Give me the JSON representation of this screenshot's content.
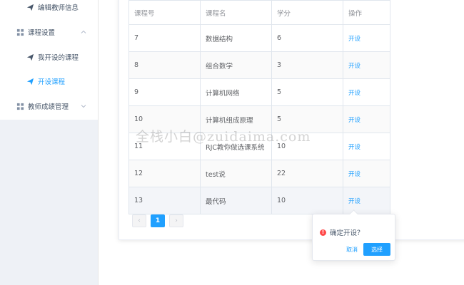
{
  "sidebar": {
    "items": [
      {
        "label": "编辑教师信息",
        "icon": "send-icon"
      },
      {
        "label": "课程设置",
        "icon": "grid-icon",
        "expanded": true
      },
      {
        "label": "我开设的课程",
        "icon": "send-icon"
      },
      {
        "label": "开设课程",
        "icon": "send-icon",
        "active": true
      },
      {
        "label": "教师成绩管理",
        "icon": "grid-icon",
        "expanded": false
      }
    ]
  },
  "table": {
    "headers": [
      "课程号",
      "课程名",
      "学分",
      "操作"
    ],
    "rows": [
      {
        "id": "7",
        "name": "数据结构",
        "credit": "6",
        "action": "开设"
      },
      {
        "id": "8",
        "name": "组合数学",
        "credit": "3",
        "action": "开设"
      },
      {
        "id": "9",
        "name": "计算机网络",
        "credit": "5",
        "action": "开设"
      },
      {
        "id": "10",
        "name": "计算机组成原理",
        "credit": "5",
        "action": "开设"
      },
      {
        "id": "11",
        "name": "RJC教你做选课系统",
        "credit": "10",
        "action": "开设"
      },
      {
        "id": "12",
        "name": "test说",
        "credit": "22",
        "action": "开设"
      },
      {
        "id": "13",
        "name": "最代码",
        "credit": "10",
        "action": "开设"
      }
    ]
  },
  "pagination": {
    "current_page": "1",
    "prev": "‹",
    "next": "›"
  },
  "popconfirm": {
    "message": "确定开设？",
    "icon": "!",
    "cancel_label": "取消",
    "confirm_label": "选择"
  },
  "watermark": "全栈小白@zuidaima.com",
  "colors": {
    "accent": "#20a0ff",
    "warning": "#ff4949",
    "sidebar_bg": "#eef1f6"
  }
}
